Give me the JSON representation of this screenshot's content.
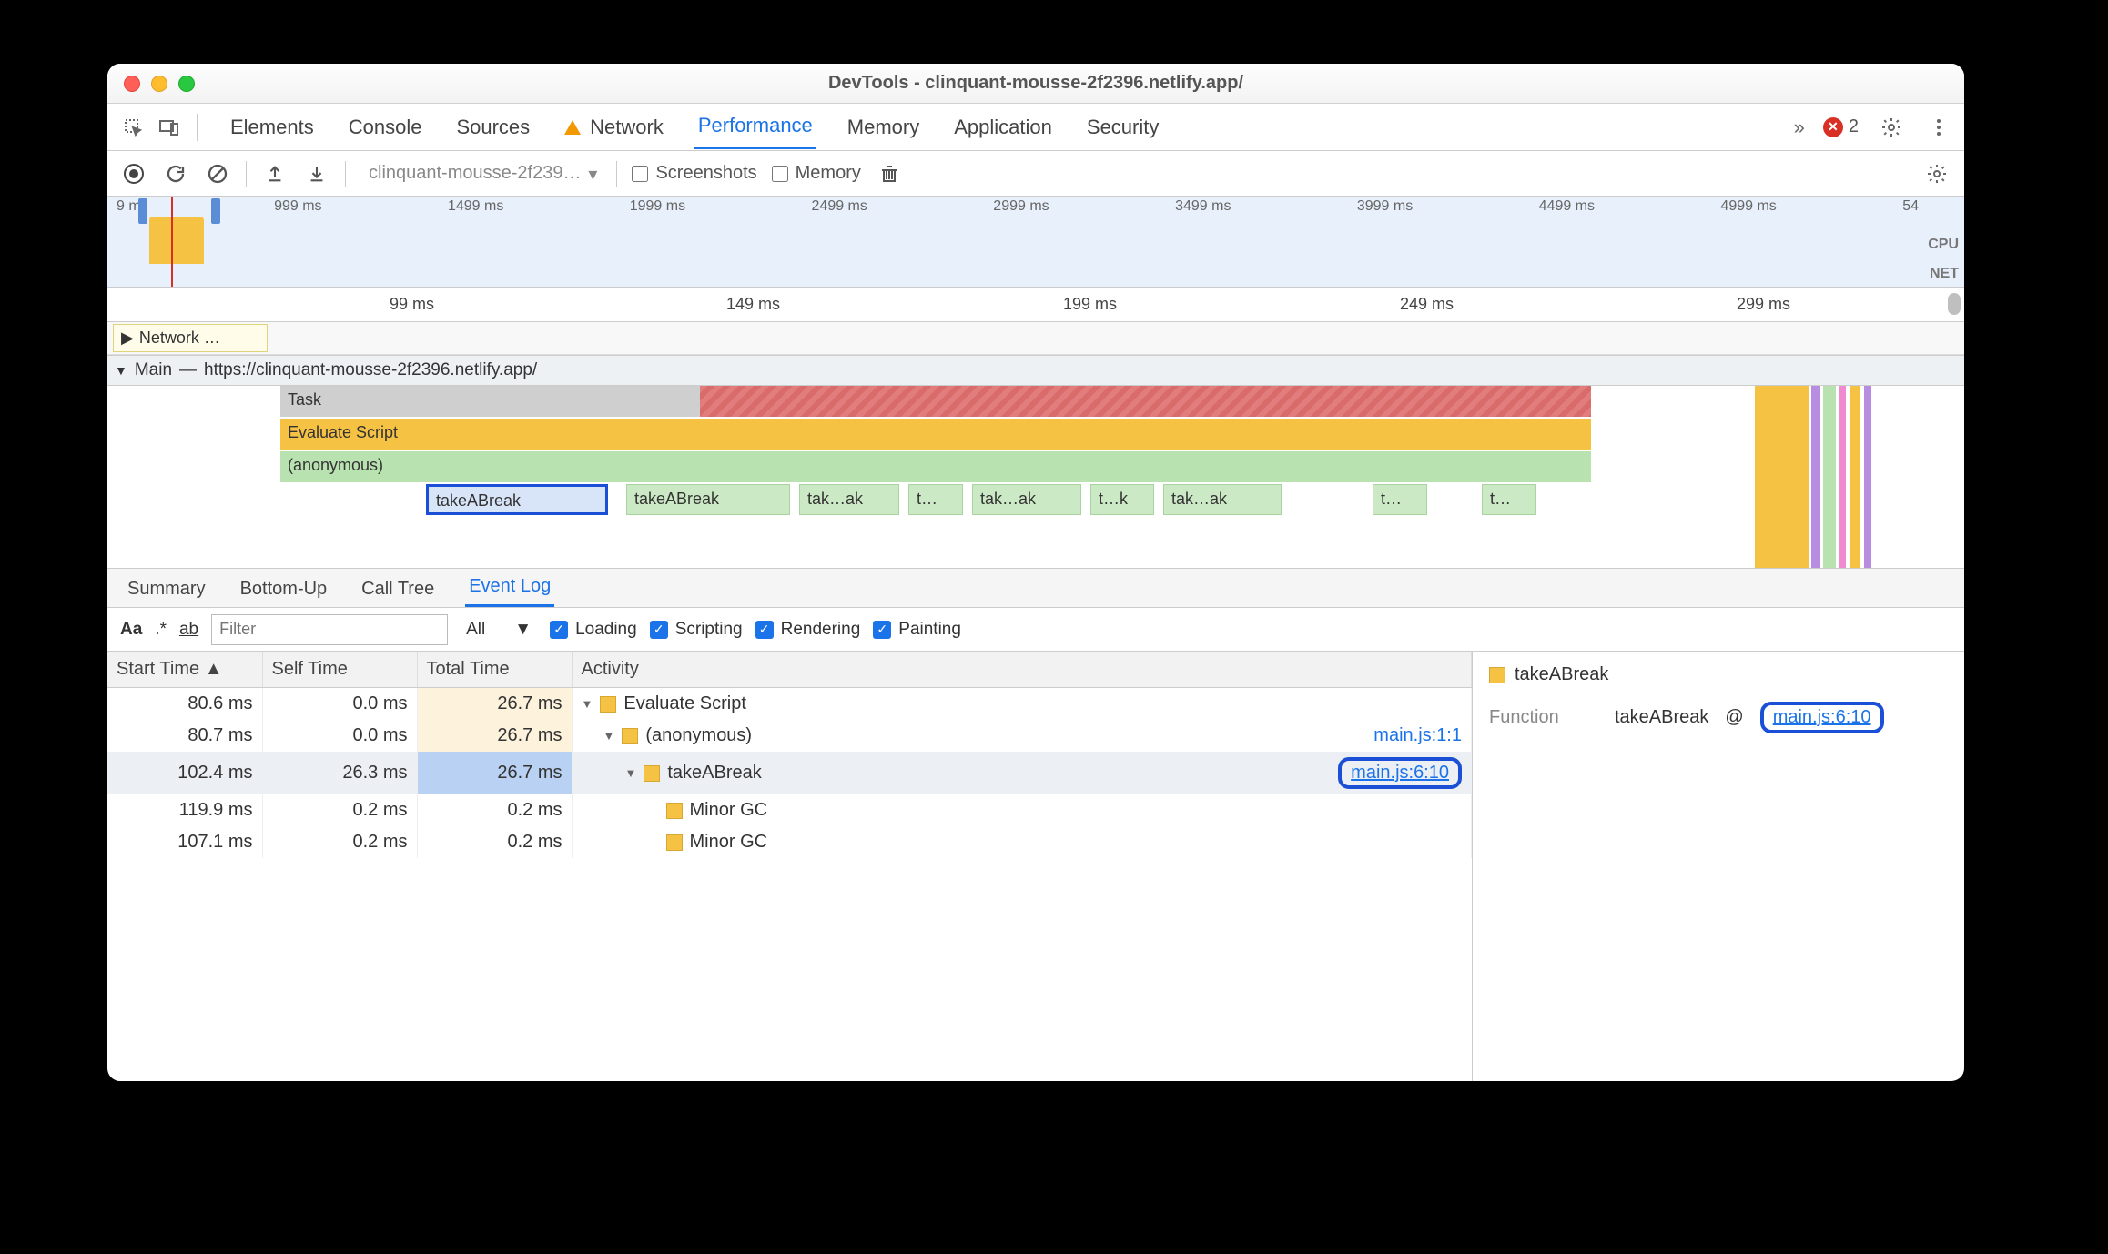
{
  "window": {
    "title": "DevTools - clinquant-mousse-2f2396.netlify.app/"
  },
  "tabs": {
    "items": [
      "Elements",
      "Console",
      "Sources",
      "Network",
      "Performance",
      "Memory",
      "Application",
      "Security"
    ],
    "active": "Performance",
    "warn": "Network",
    "overflow": "»",
    "error_count": "2"
  },
  "toolbar": {
    "page_selector": "clinquant-mousse-2f239…",
    "screenshots_label": "Screenshots",
    "memory_label": "Memory"
  },
  "overview": {
    "ticks": [
      "9 ms",
      "999 ms",
      "1499 ms",
      "1999 ms",
      "2499 ms",
      "2999 ms",
      "3499 ms",
      "3999 ms",
      "4499 ms",
      "4999 ms",
      "54"
    ],
    "cpu_label": "CPU",
    "net_label": "NET"
  },
  "ruler2": [
    "99 ms",
    "149 ms",
    "199 ms",
    "249 ms",
    "299 ms"
  ],
  "network_row_label": "Network …",
  "main_track": {
    "label": "Main",
    "url": "https://clinquant-mousse-2f2396.netlify.app/",
    "rows": {
      "task": "Task",
      "evaluate": "Evaluate Script",
      "anon": "(anonymous)",
      "calls": [
        "takeABreak",
        "takeABreak",
        "tak…ak",
        "t…",
        "tak…ak",
        "t…k",
        "tak…ak",
        "t…",
        "t…"
      ]
    }
  },
  "detail_tabs": [
    "Summary",
    "Bottom-Up",
    "Call Tree",
    "Event Log"
  ],
  "detail_active": "Event Log",
  "filter": {
    "case_sensitive": "Aa",
    "regex": ".*",
    "match_whole": "ab",
    "placeholder": "Filter",
    "level": "All",
    "checks": [
      "Loading",
      "Scripting",
      "Rendering",
      "Painting"
    ]
  },
  "columns": [
    "Start Time",
    "Self Time",
    "Total Time",
    "Activity"
  ],
  "events": [
    {
      "start": "80.6 ms",
      "self": "0.0 ms",
      "total": "26.7 ms",
      "indent": 0,
      "tri": "▼",
      "icon": "script",
      "name": "Evaluate Script",
      "link": "",
      "hot": true
    },
    {
      "start": "80.7 ms",
      "self": "0.0 ms",
      "total": "26.7 ms",
      "indent": 1,
      "tri": "▼",
      "icon": "script",
      "name": "(anonymous)",
      "link": "main.js:1:1",
      "hot": true
    },
    {
      "start": "102.4 ms",
      "self": "26.3 ms",
      "total": "26.7 ms",
      "indent": 2,
      "tri": "▼",
      "icon": "script",
      "name": "takeABreak",
      "link": "main.js:6:10",
      "hot": true,
      "sel": true,
      "circled": true
    },
    {
      "start": "119.9 ms",
      "self": "0.2 ms",
      "total": "0.2 ms",
      "indent": 3,
      "tri": "",
      "icon": "script",
      "name": "Minor GC",
      "link": ""
    },
    {
      "start": "107.1 ms",
      "self": "0.2 ms",
      "total": "0.2 ms",
      "indent": 3,
      "tri": "",
      "icon": "script",
      "name": "Minor GC",
      "link": ""
    }
  ],
  "details": {
    "title": "takeABreak",
    "function_label": "Function",
    "function_name": "takeABreak",
    "at": "@",
    "link": "main.js:6:10"
  }
}
